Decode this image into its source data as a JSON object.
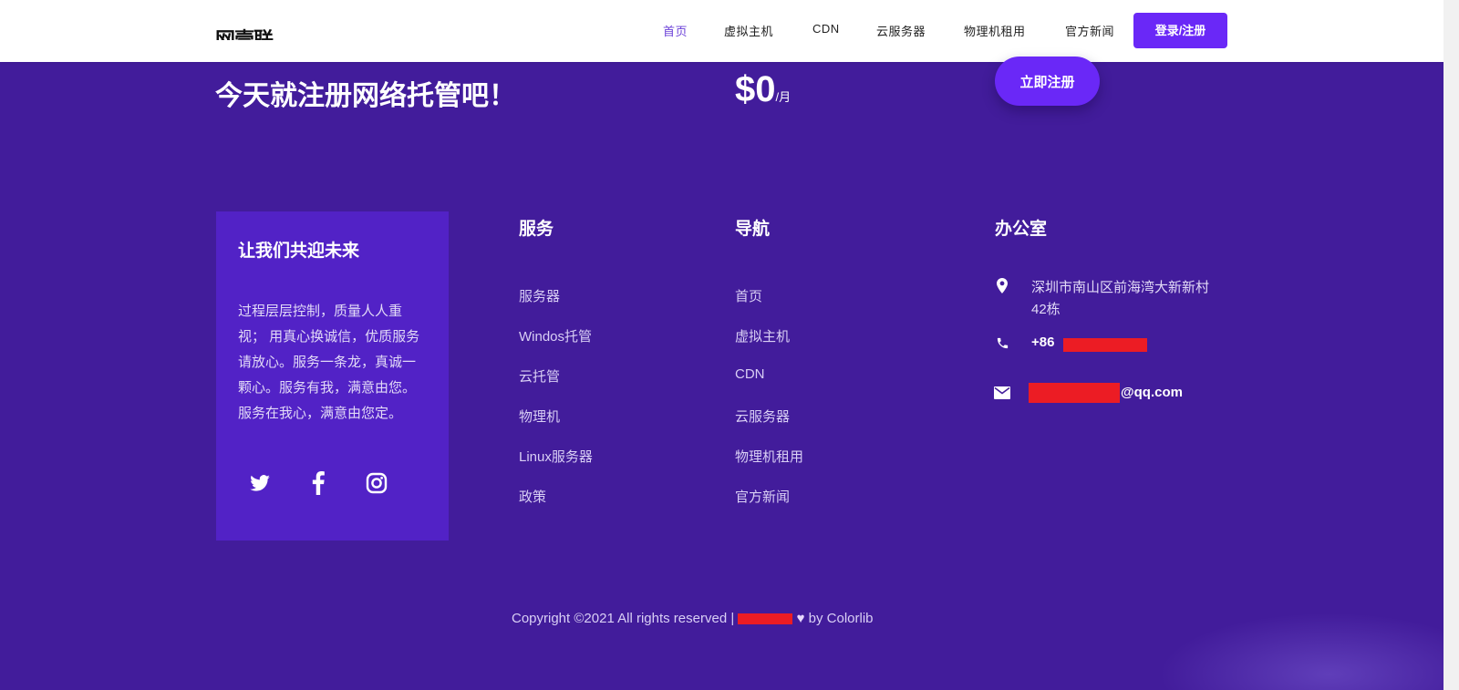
{
  "header": {
    "logo_text": "网壹联",
    "nav": [
      {
        "label": "首页",
        "active": true
      },
      {
        "label": "虚拟主机"
      },
      {
        "label": "CDN"
      },
      {
        "label": "云服务器"
      },
      {
        "label": "物理机租用"
      },
      {
        "label": "官方新闻"
      }
    ],
    "login_label": "登录/注册"
  },
  "cta": {
    "title": "今天就注册网络托管吧！",
    "price_amount": "$0",
    "price_period": "/月",
    "button_label": "立即注册"
  },
  "about": {
    "title": "让我们共迎未来",
    "text": "过程层层控制，质量人人重视； 用真心换诚信，优质服务请放心。服务一条龙，真诚一颗心。服务有我，满意由您。服务在我心，满意由您定。",
    "social": [
      "twitter-icon",
      "facebook-icon",
      "instagram-icon"
    ]
  },
  "services": {
    "title": "服务",
    "links": [
      "服务器",
      "Windos托管",
      "云托管",
      "物理机",
      "Linux服务器",
      "政策"
    ]
  },
  "navigation": {
    "title": "导航",
    "links": [
      "首页",
      "虚拟主机",
      "CDN",
      "云服务器",
      "物理机租用",
      "官方新闻"
    ]
  },
  "office": {
    "title": "办公室",
    "address_line1": "深圳市南山区前海湾大新新村",
    "address_line2": "42栋",
    "phone_prefix": "+86",
    "email_suffix": "@qq.com"
  },
  "footer": {
    "copyright_prefix": "Copyright ©2021 All rights reserved |",
    "copyright_suffix": "by Colorlib"
  },
  "colors": {
    "background": "#421c9b",
    "card": "#5222c6",
    "accent": "#6a28f7",
    "redaction": "#ec1c24"
  }
}
